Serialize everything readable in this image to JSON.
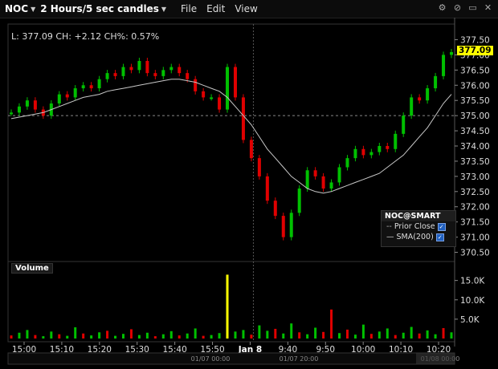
{
  "window": {
    "symbol": "NOC",
    "period": "2 Hours/5 sec candles",
    "menus": [
      "File",
      "Edit",
      "View"
    ]
  },
  "info_line": "L: 377.09 CH: +2.12 CH%: 0.57%",
  "last_price": "377.09",
  "legend": {
    "title": "NOC@SMART",
    "items": [
      "Prior Close",
      "SMA(200)"
    ]
  },
  "volume_label": "Volume",
  "chart_data": [
    {
      "type": "line",
      "title": "",
      "ylabel": "",
      "ylim": [
        370.25,
        377.75
      ],
      "y_ticks": [
        "377.50",
        "377.00",
        "376.50",
        "376.00",
        "375.50",
        "375.00",
        "374.50",
        "374.00",
        "373.50",
        "373.00",
        "372.50",
        "372.00",
        "371.50",
        "371.00",
        "370.50"
      ],
      "x_ticks": [
        "15:00",
        "15:10",
        "15:20",
        "15:30",
        "15:40",
        "15:50",
        "Jan 8",
        "9:40",
        "9:50",
        "10:00",
        "10:10",
        "10:20"
      ],
      "prior_close": 375.0,
      "series": [
        {
          "name": "Price",
          "values": [
            375.1,
            375.3,
            375.5,
            375.2,
            375.0,
            375.4,
            375.7,
            375.6,
            375.9,
            376.0,
            375.9,
            376.2,
            376.4,
            376.3,
            376.6,
            376.5,
            376.8,
            376.4,
            376.3,
            376.5,
            376.6,
            376.4,
            376.2,
            375.8,
            375.6,
            375.6,
            375.2,
            376.6,
            375.6,
            374.2,
            373.6,
            373.0,
            372.2,
            371.7,
            371.0,
            371.8,
            372.6,
            373.2,
            373.0,
            372.6,
            372.8,
            373.3,
            373.6,
            373.9,
            373.7,
            373.8,
            374.0,
            373.9,
            374.4,
            375.0,
            375.6,
            375.5,
            375.9,
            376.3,
            377.0,
            377.09
          ]
        },
        {
          "name": "SMA(200)",
          "values": [
            374.9,
            374.95,
            375.0,
            375.05,
            375.1,
            375.2,
            375.3,
            375.4,
            375.5,
            375.6,
            375.65,
            375.7,
            375.8,
            375.85,
            375.9,
            375.95,
            376.0,
            376.05,
            376.1,
            376.15,
            376.2,
            376.2,
            376.15,
            376.1,
            376.0,
            375.9,
            375.8,
            375.6,
            375.3,
            375.0,
            374.7,
            374.3,
            373.9,
            373.6,
            373.3,
            373.0,
            372.8,
            372.6,
            372.5,
            372.45,
            372.5,
            372.6,
            372.7,
            372.8,
            372.9,
            373.0,
            373.1,
            373.3,
            373.5,
            373.7,
            374.0,
            374.3,
            374.6,
            375.0,
            375.4,
            375.7
          ]
        }
      ]
    },
    {
      "type": "bar",
      "title": "",
      "ylabel": "",
      "ylim": [
        0,
        17000
      ],
      "y_ticks": [
        "15.0K",
        "10.0K",
        "5.0K"
      ],
      "series": [
        {
          "name": "Volume",
          "values": [
            800,
            1500,
            2200,
            900,
            600,
            1800,
            1100,
            700,
            2900,
            1300,
            800,
            1600,
            2000,
            700,
            1200,
            2400,
            900,
            1500,
            600,
            1100,
            1900,
            800,
            1300,
            2600,
            700,
            900,
            1400,
            16500,
            1800,
            2200,
            1000,
            3400,
            2000,
            2500,
            1300,
            3900,
            1600,
            1100,
            2800,
            1700,
            7500,
            1400,
            2300,
            1000,
            3600,
            1200,
            1800,
            2600,
            900,
            1500,
            3000,
            1300,
            2100,
            1100,
            2700,
            1600
          ]
        }
      ]
    }
  ],
  "bottom_ticks": [
    "01/07 00:00",
    "01/07 20:00",
    "01/08 00:00"
  ],
  "colors": {
    "up": "#00c000",
    "down": "#e00000",
    "sma": "#c8c8c8",
    "volume_spike": "#ffff00"
  }
}
